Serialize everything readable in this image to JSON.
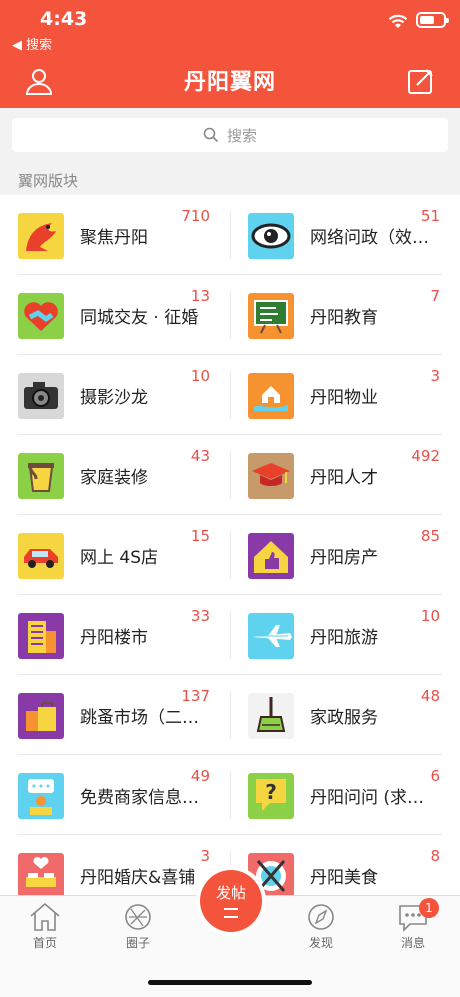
{
  "status": {
    "time": "4:43",
    "back": "◀ 搜索"
  },
  "header": {
    "title": "丹阳翼网"
  },
  "search": {
    "placeholder": "搜索"
  },
  "section": {
    "title": "翼网版块"
  },
  "boards": [
    {
      "name": "聚焦丹阳",
      "count": "710",
      "icon": "phoenix-icon",
      "bg": "#f6d640"
    },
    {
      "name": "网络问政（效…",
      "count": "51",
      "icon": "eye-icon",
      "bg": "#5ed2ee"
    },
    {
      "name": "同城交友 · 征婚",
      "count": "13",
      "icon": "handshake-heart-icon",
      "bg": "#8bd046"
    },
    {
      "name": "丹阳教育",
      "count": "7",
      "icon": "chalkboard-icon",
      "bg": "#f69230"
    },
    {
      "name": "摄影沙龙",
      "count": "10",
      "icon": "camera-icon",
      "bg": "#d8d8d8"
    },
    {
      "name": "丹阳物业",
      "count": "3",
      "icon": "house-hand-icon",
      "bg": "#f69230"
    },
    {
      "name": "家庭装修",
      "count": "43",
      "icon": "paint-bucket-icon",
      "bg": "#8bd046"
    },
    {
      "name": "丹阳人才",
      "count": "492",
      "icon": "graduation-cap-icon",
      "bg": "#c79a6a"
    },
    {
      "name": "网上 4S店",
      "count": "15",
      "icon": "car-icon",
      "bg": "#f6d640"
    },
    {
      "name": "丹阳房产",
      "count": "85",
      "icon": "house-thumb-icon",
      "bg": "#8a3aa6"
    },
    {
      "name": "丹阳楼市",
      "count": "33",
      "icon": "building-icon",
      "bg": "#8a3aa6"
    },
    {
      "name": "丹阳旅游",
      "count": "10",
      "icon": "airplane-icon",
      "bg": "#5ed2ee"
    },
    {
      "name": "跳蚤市场（二…",
      "count": "137",
      "icon": "shopping-bags-icon",
      "bg": "#8a3aa6"
    },
    {
      "name": "家政服务",
      "count": "48",
      "icon": "broom-icon",
      "bg": "#f2f2f2"
    },
    {
      "name": "免费商家信息…",
      "count": "49",
      "icon": "merchant-icon",
      "bg": "#5ed2ee"
    },
    {
      "name": "丹阳问问 (求…",
      "count": "6",
      "icon": "question-bubble-icon",
      "bg": "#8bd046"
    },
    {
      "name": "丹阳婚庆&喜铺",
      "count": "3",
      "icon": "wedding-bed-icon",
      "bg": "#f06a6a"
    },
    {
      "name": "丹阳美食",
      "count": "8",
      "icon": "food-plate-icon",
      "bg": "#f06a6a"
    }
  ],
  "tabbar": {
    "home": "首页",
    "circle": "圈子",
    "post": "发帖",
    "discover": "发现",
    "messages": "消息",
    "messages_badge": "1"
  },
  "colors": {
    "brand": "#f4533c",
    "count": "#e8504a"
  }
}
